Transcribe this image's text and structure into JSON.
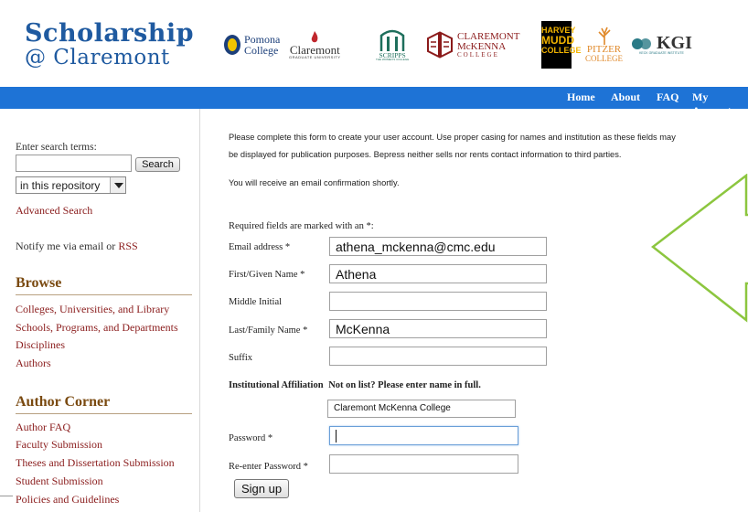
{
  "site": {
    "title_line1": "Scholarship",
    "title_line2": "@ Claremont"
  },
  "logos": {
    "pomona_line1": "Pomona",
    "pomona_line2": "College",
    "cgu_name": "Claremont",
    "cgu_sub": "GRADUATE UNIVERSITY",
    "scripps_name": "SCRIPPS",
    "scripps_sub": "THE WOMEN'S COLLEGE",
    "cmc_line1": "CLAREMONT",
    "cmc_line2": "McKENNA",
    "cmc_line3": "COLLEGE",
    "hmc_line1": "HARVEY",
    "hmc_line2": "MUDD",
    "hmc_line3": "COLLEGE",
    "pitzer_line1": "PITZER",
    "pitzer_line2": "COLLEGE",
    "kgi_name": "KGI",
    "kgi_sub": "KECK GRADUATE INSTITUTE"
  },
  "nav": {
    "home": "Home",
    "about": "About",
    "faq": "FAQ",
    "account": "My Account"
  },
  "sidebar": {
    "search_label": "Enter search terms:",
    "search_value": "",
    "search_button": "Search",
    "scope_value": "in this repository",
    "advanced_search": "Advanced Search",
    "notify_text": "Notify me via email or",
    "rss": "RSS",
    "browse_heading": "Browse",
    "browse_items": [
      "Colleges, Universities, and Library",
      "Schools, Programs, and Departments",
      "Disciplines",
      "Authors"
    ],
    "author_corner_heading": "Author Corner",
    "author_items": [
      "Author FAQ",
      "Faculty Submission",
      "Theses and Dissertation Submission",
      "Student Submission",
      "Policies and Guidelines"
    ]
  },
  "form": {
    "intro_line1": "Please complete this form to create your user account. Use proper casing for names and institution as these fields may",
    "intro_line2": "be displayed for publication purposes. Bepress neither sells nor rents contact information to third parties.",
    "intro_line3": "You will receive an email confirmation shortly.",
    "required_note": "Required fields are marked with an *:",
    "email_label": "Email address *",
    "email_value": "athena_mckenna@cmc.edu",
    "first_label": "First/Given Name *",
    "first_value": "Athena",
    "middle_label": "Middle Initial",
    "middle_value": "",
    "last_label": "Last/Family Name *",
    "last_value": "McKenna",
    "suffix_label": "Suffix",
    "suffix_value": "",
    "affil_label": "Institutional Affiliation",
    "affil_note": "Not on list? Please enter name in full.",
    "affil_value": "Claremont McKenna College",
    "password_label": "Password *",
    "reenter_label": "Re-enter Password *",
    "signup_button": "Sign up"
  },
  "colors": {
    "nav_bar": "#1e73d6",
    "title_blue": "#1f5aa0",
    "link_red": "#8a1c1c",
    "heading_brown": "#7a4a10",
    "arrow_green": "#8cc63f"
  }
}
